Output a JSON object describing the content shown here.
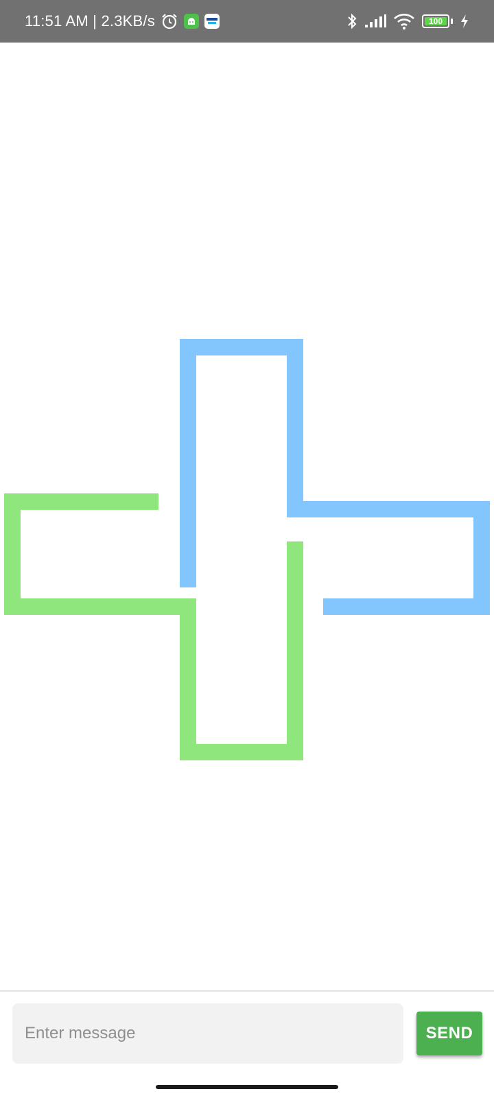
{
  "status_bar": {
    "time_speed": "11:51 AM | 2.3KB/s",
    "battery_level": "100",
    "icons": [
      "alarm-icon",
      "android-app-icon",
      "paytm-app-icon",
      "bluetooth-icon",
      "signal-icon",
      "wifi-icon",
      "battery-icon",
      "charging-icon"
    ],
    "colors": {
      "background": "#717171",
      "battery_fill": "#5fd34a"
    }
  },
  "drawing": {
    "shapes": [
      {
        "name": "blue-stroke-path",
        "color": "#82c6fd"
      },
      {
        "name": "green-stroke-path",
        "color": "#8ee67c"
      }
    ]
  },
  "composer": {
    "placeholder": "Enter message",
    "value": "",
    "send_label": "SEND",
    "colors": {
      "send_button": "#4caf50",
      "input_background": "#f2f2f2"
    }
  }
}
